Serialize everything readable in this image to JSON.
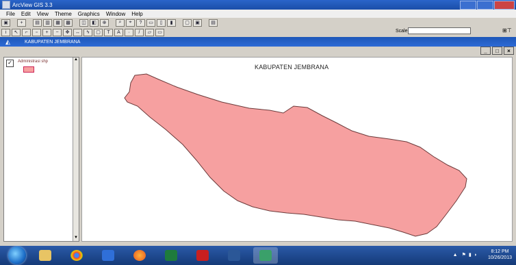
{
  "window": {
    "title": "ArcView GIS 3.3"
  },
  "menu": [
    "File",
    "Edit",
    "View",
    "Theme",
    "Graphics",
    "Window",
    "Help"
  ],
  "toolbar": {
    "scale_label": "Scale 1:",
    "scale_value": ""
  },
  "view": {
    "title": "KABUPATEN JEMBRANA"
  },
  "toc": {
    "layers": [
      {
        "name": "Administrasi shp",
        "checked": "✓",
        "color": "#f6a0a0"
      }
    ]
  },
  "map": {
    "title": "KABUPATEN JEMBRANA",
    "fill": "#f6a0a0",
    "stroke": "#6b3a3a"
  },
  "taskbar": {
    "time": "8:12 PM",
    "date": "10/26/2013"
  }
}
